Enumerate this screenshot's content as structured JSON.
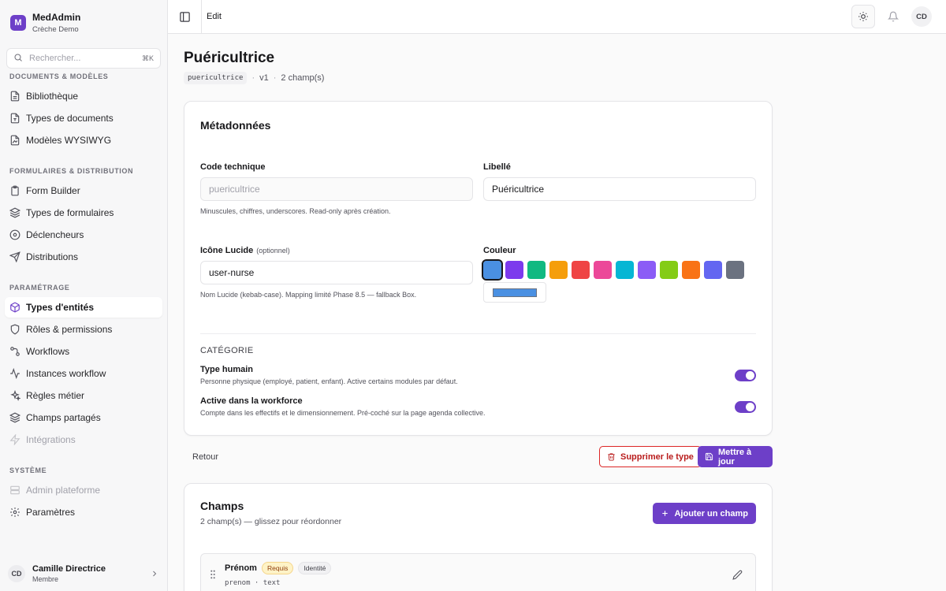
{
  "app": {
    "name": "MedAdmin",
    "tenant": "Crèche Demo",
    "logo_letter": "M"
  },
  "search": {
    "placeholder": "Rechercher...",
    "shortcut": "⌘K"
  },
  "sidebar": {
    "sections": [
      {
        "title": "DOCUMENTS & MODÈLES",
        "items": [
          {
            "label": "Bibliothèque",
            "icon": "file-text-icon"
          },
          {
            "label": "Types de documents",
            "icon": "file-type-icon"
          },
          {
            "label": "Modèles WYSIWYG",
            "icon": "file-image-icon"
          }
        ]
      },
      {
        "title": "FORMULAIRES & DISTRIBUTION",
        "items": [
          {
            "label": "Form Builder",
            "icon": "clipboard-icon"
          },
          {
            "label": "Types de formulaires",
            "icon": "layers-icon"
          },
          {
            "label": "Déclencheurs",
            "icon": "play-circle-icon"
          },
          {
            "label": "Distributions",
            "icon": "send-icon"
          }
        ]
      },
      {
        "title": "PARAMÉTRAGE",
        "items": [
          {
            "label": "Types d'entités",
            "icon": "box-icon",
            "active": true
          },
          {
            "label": "Rôles & permissions",
            "icon": "shield-icon"
          },
          {
            "label": "Workflows",
            "icon": "workflow-icon"
          },
          {
            "label": "Instances workflow",
            "icon": "activity-icon"
          },
          {
            "label": "Règles métier",
            "icon": "sparkles-icon"
          },
          {
            "label": "Champs partagés",
            "icon": "layers-icon"
          },
          {
            "label": "Intégrations",
            "icon": "plug-icon",
            "disabled": true
          }
        ]
      },
      {
        "title": "SYSTÈME",
        "items": [
          {
            "label": "Admin plateforme",
            "icon": "database-icon",
            "disabled": true
          },
          {
            "label": "Paramètres",
            "icon": "gear-icon"
          }
        ]
      }
    ]
  },
  "user": {
    "initials": "CD",
    "name": "Camille Directrice",
    "role": "Membre"
  },
  "topbar": {
    "breadcrumb": "Edit",
    "avatar_initials": "CD"
  },
  "page": {
    "title": "Puéricultrice",
    "code": "puericultrice",
    "version": "v1",
    "field_count": "2 champ(s)"
  },
  "metadata": {
    "title": "Métadonnées",
    "code_label": "Code technique",
    "code_value": "puericultrice",
    "code_help": "Minuscules, chiffres, underscores. Read-only après création.",
    "label_label": "Libellé",
    "label_value": "Puéricultrice",
    "icon_label": "Icône Lucide",
    "icon_optional": "(optionnel)",
    "icon_value": "user-nurse",
    "icon_help": "Nom Lucide (kebab-case). Mapping limité Phase 8.5 — fallback Box.",
    "color_label": "Couleur",
    "colors": [
      "#4a90e2",
      "#7c3aed",
      "#10b981",
      "#f59e0b",
      "#ef4444",
      "#ec4899",
      "#06b6d4",
      "#8b5cf6",
      "#84cc16",
      "#f97316",
      "#6366f1",
      "#6b7280"
    ],
    "selected_color": "#4a90e2",
    "category_title": "CATÉGORIE",
    "toggles": [
      {
        "title": "Type humain",
        "desc": "Personne physique (employé, patient, enfant). Active certains modules par défaut.",
        "on": true
      },
      {
        "title": "Active dans la workforce",
        "desc": "Compte dans les effectifs et le dimensionnement. Pré-coché sur la page agenda collective.",
        "on": true
      }
    ]
  },
  "actions": {
    "back": "Retour",
    "delete": "Supprimer le type",
    "update": "Mettre à jour"
  },
  "fields": {
    "title": "Champs",
    "subtitle": "2 champ(s) — glissez pour réordonner",
    "add": "Ajouter un champ",
    "items": [
      {
        "name": "Prénom",
        "required": "Requis",
        "identity": "Identité",
        "key": "prenom",
        "type": "text"
      }
    ]
  }
}
